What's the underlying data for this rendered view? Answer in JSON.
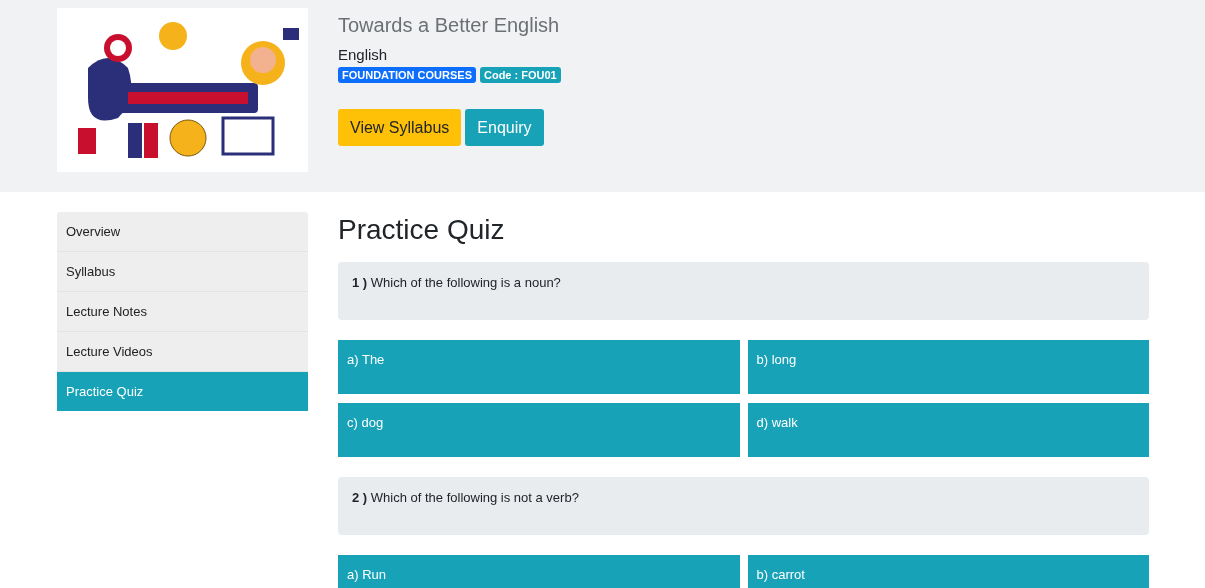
{
  "course": {
    "title": "Towards a Better English",
    "subject": "English",
    "badges": [
      {
        "label": "FOUNDATION COURSES",
        "kind": "category"
      },
      {
        "label": "Code : FOU01",
        "kind": "code"
      }
    ],
    "buttons": [
      {
        "label": "View Syllabus",
        "kind": "primary"
      },
      {
        "label": "Enquiry",
        "kind": "secondary"
      }
    ]
  },
  "sidebar": {
    "items": [
      {
        "label": "Overview",
        "selected": false
      },
      {
        "label": "Syllabus",
        "selected": false
      },
      {
        "label": "Lecture Notes",
        "selected": false
      },
      {
        "label": "Lecture Videos",
        "selected": false
      },
      {
        "label": "Practice Quiz",
        "selected": true
      }
    ]
  },
  "quiz": {
    "heading": "Practice Quiz",
    "questions": [
      {
        "text": "**1 )** Which of the following is a noun?",
        "options": [
          "a) The",
          "b) long",
          "c) dog",
          "d) walk"
        ]
      },
      {
        "text": "**2 )** Which of the following is not a verb?",
        "options": [
          "a) Run",
          "b) carrot"
        ]
      }
    ]
  }
}
